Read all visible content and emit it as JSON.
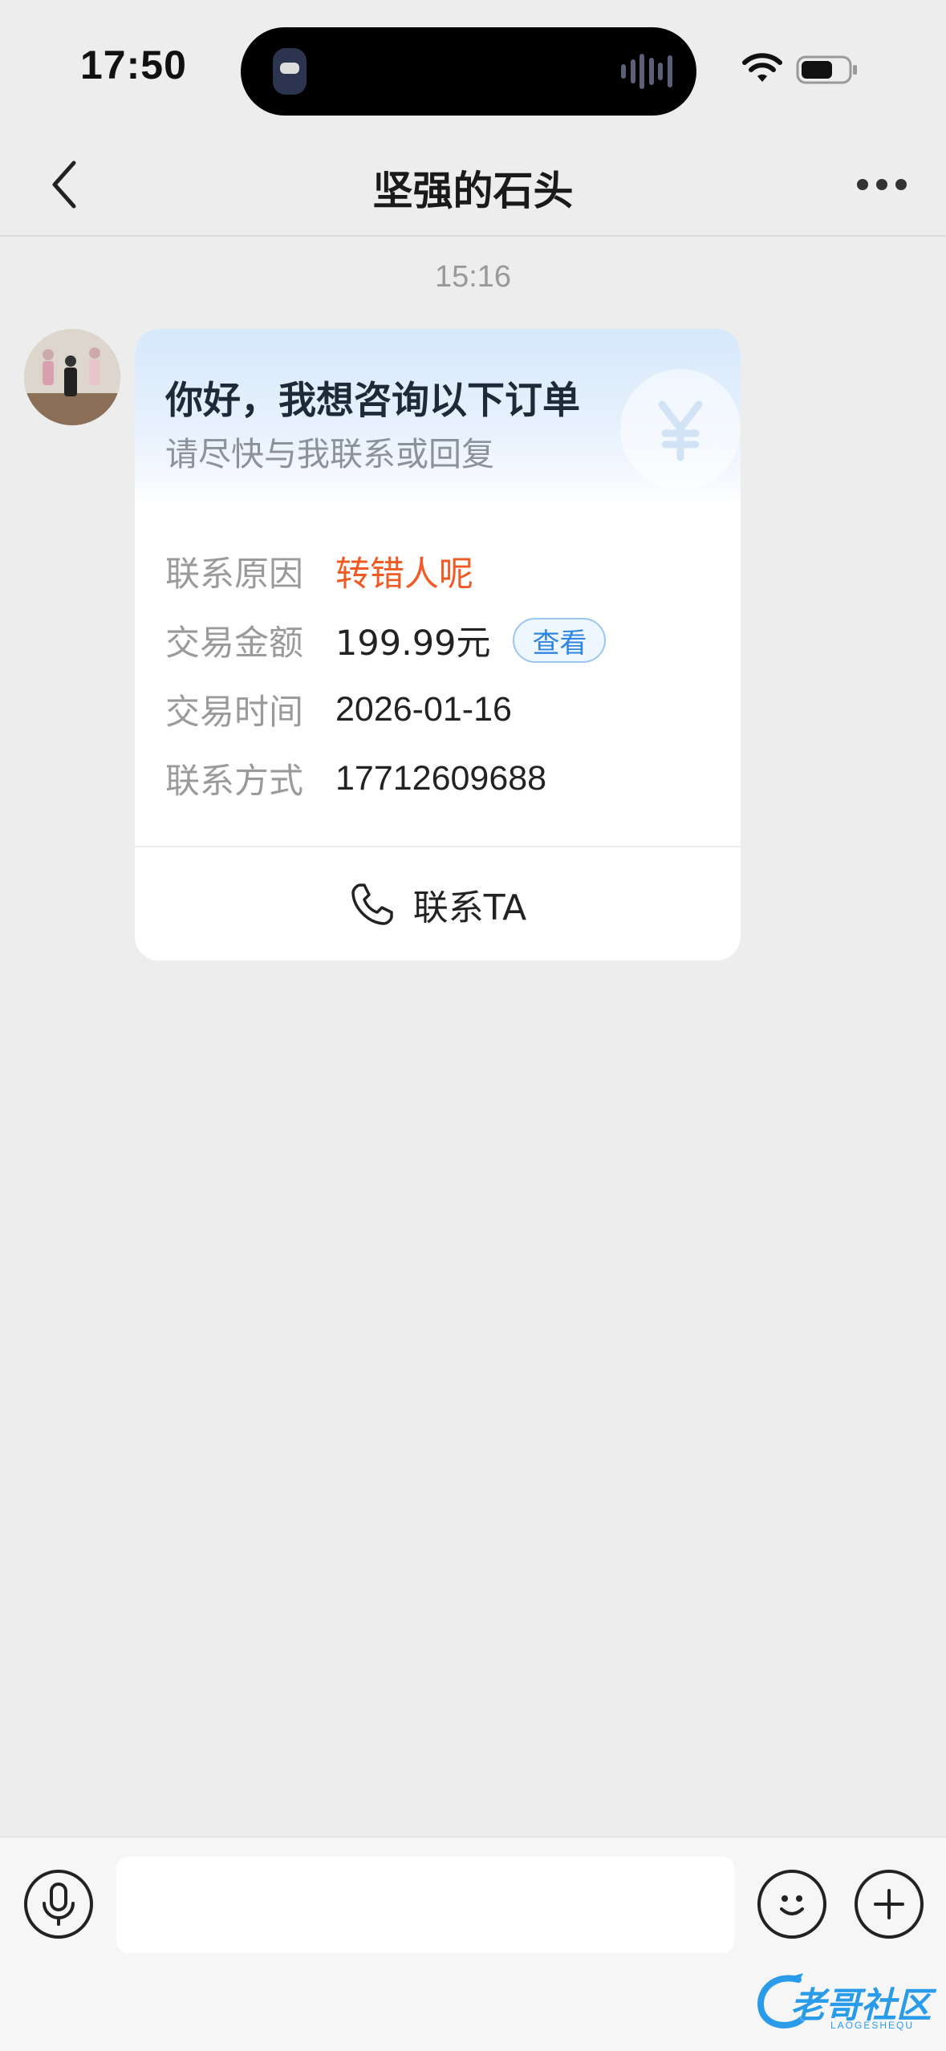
{
  "status_bar": {
    "time": "17:50"
  },
  "nav": {
    "title": "坚强的石头"
  },
  "chat": {
    "timestamp": "15:16",
    "card": {
      "title": "你好，我想咨询以下订单",
      "subtitle": "请尽快与我联系或回复",
      "rows": [
        {
          "label": "联系原因",
          "value": "转错人呢"
        },
        {
          "label": "交易金额",
          "value": "199.99元",
          "badge": "查看"
        },
        {
          "label": "交易时间",
          "value": "2026-01-16"
        },
        {
          "label": "联系方式",
          "value": "17712609688"
        }
      ],
      "contact_label": "联系TA"
    }
  },
  "input_bar": {
    "placeholder": ""
  },
  "watermark": {
    "text": "老哥社区",
    "sub": "LAOGESHEQU"
  },
  "colors": {
    "background": "#ededed",
    "accent_orange": "#f05a24",
    "accent_blue": "#2f86e0"
  },
  "icons": [
    "back-arrow-icon",
    "more-dots-icon",
    "yen-icon",
    "phone-icon",
    "microphone-icon",
    "smiley-icon",
    "plus-icon",
    "wifi-icon",
    "battery-icon"
  ]
}
